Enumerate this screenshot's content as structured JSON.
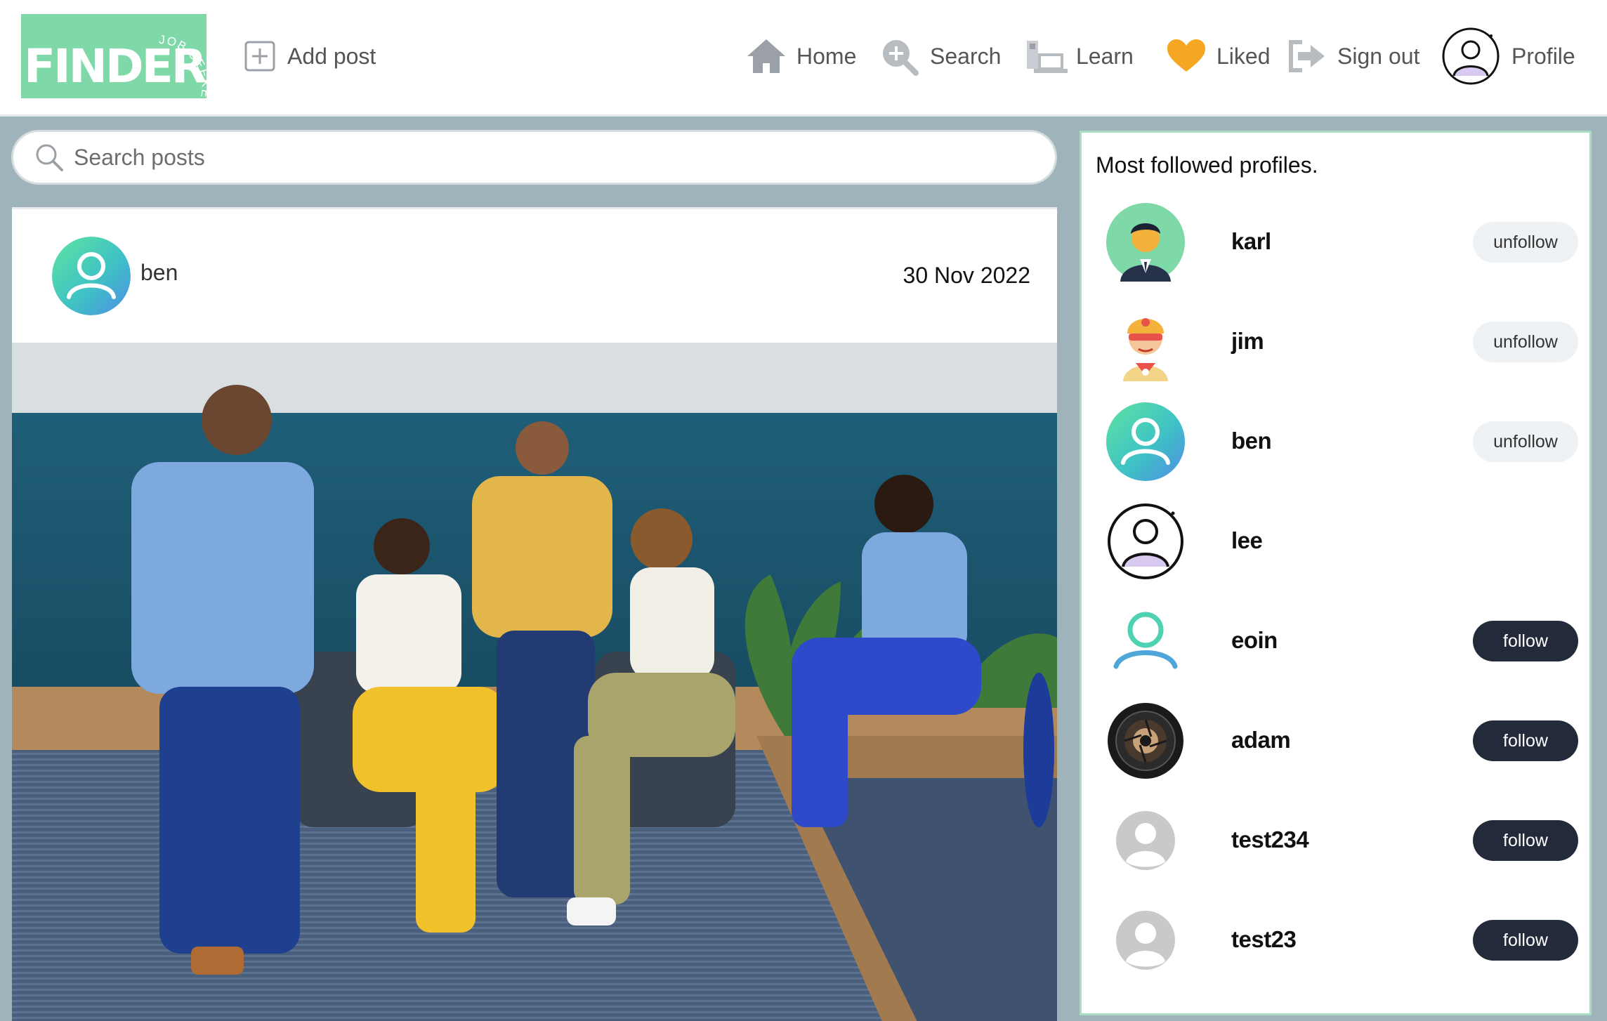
{
  "header": {
    "logo": {
      "word": "FINDER",
      "tagline": "JOB SEEKERS"
    },
    "add_post_label": "Add post",
    "nav": [
      {
        "label": "Home",
        "icon": "home-icon"
      },
      {
        "label": "Search",
        "icon": "search-plus-icon"
      },
      {
        "label": "Learn",
        "icon": "learn-icon"
      },
      {
        "label": "Liked",
        "icon": "heart-icon"
      },
      {
        "label": "Sign out",
        "icon": "sign-out-icon"
      },
      {
        "label": "Profile",
        "icon": "profile-avatar-icon"
      }
    ]
  },
  "search": {
    "placeholder": "Search posts",
    "icon": "magnifier-icon"
  },
  "post": {
    "username": "ben",
    "date": "30 Nov 2022",
    "image": "group-of-five-people-in-office-photo"
  },
  "sidebar": {
    "title": "Most followed profiles.",
    "profiles": [
      {
        "name": "karl",
        "button": "unfollow",
        "avatar": "businessman-avatar"
      },
      {
        "name": "jim",
        "button": "unfollow",
        "avatar": "superhero-avatar"
      },
      {
        "name": "ben",
        "button": "unfollow",
        "avatar": "gradient-user-avatar"
      },
      {
        "name": "lee",
        "button": "",
        "avatar": "outlined-user-avatar"
      },
      {
        "name": "eoin",
        "button": "follow",
        "avatar": "teal-outline-user-avatar"
      },
      {
        "name": "adam",
        "button": "follow",
        "avatar": "camera-lens-avatar"
      },
      {
        "name": "test234",
        "button": "follow",
        "avatar": "default-grey-avatar"
      },
      {
        "name": "test23",
        "button": "follow",
        "avatar": "default-grey-avatar"
      }
    ]
  },
  "colors": {
    "page_bg": "#9fb3ba",
    "logo_bg": "#7ed8a8",
    "follow_bg": "#232a3a",
    "unfollow_bg": "#eef2f4",
    "liked_heart": "#f5a623",
    "sidebar_border": "#a9ddc2"
  }
}
